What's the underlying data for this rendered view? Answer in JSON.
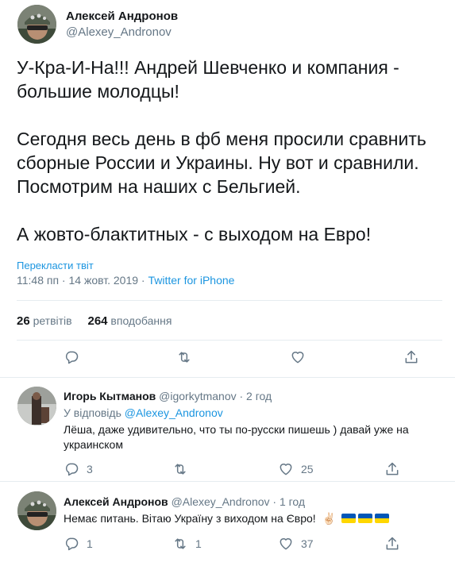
{
  "main_tweet": {
    "author_name": "Алексей Андронов",
    "author_handle": "@Alexey_Andronov",
    "text": "У-Кра-И-На!!! Андрей Шевченко и компания -\nбольшие молодцы!\n\nСегодня весь день в фб меня просили сравнить\nсборные России и Украины. Ну вот и сравнили.\nПосмотрим на наших с Бельгией.\n\nА жовто-блактитных - с выходом на Евро!",
    "translate_label": "Перекласти твіт",
    "time": "11:48 пп",
    "date": "14 жовт. 2019",
    "separator": " · ",
    "source": "Twitter for iPhone",
    "retweets_count": "26",
    "retweets_label": "ретвітів",
    "likes_count": "264",
    "likes_label": "вподобання"
  },
  "replies": [
    {
      "author_name": "Игорь Кытманов",
      "author_handle": "@igorkytmanov",
      "time": "· 2 год",
      "replying_to_prefix": "У відповідь",
      "replying_to_handle": "@Alexey_Andronov",
      "text": "Лёша, даже удивительно, что ты по-русски пишешь ) давай уже на украинском",
      "reply_count": "3",
      "retweet_count": "",
      "like_count": "25"
    },
    {
      "author_name": "Алексей Андронов",
      "author_handle": "@Alexey_Andronov",
      "time": "· 1 год",
      "text": "Немає питань. Вітаю Україну з виходом на Євро!",
      "emoji": "✌🏻",
      "reply_count": "1",
      "retweet_count": "1",
      "like_count": "37"
    }
  ],
  "icons": {
    "reply": "reply-icon",
    "retweet": "retweet-icon",
    "like": "heart-icon",
    "share": "share-icon"
  },
  "colors": {
    "link": "#1b95e0",
    "secondary_text": "#657786",
    "divider": "#e6ecf0",
    "flag_blue": "#0057b7",
    "flag_yellow": "#ffd700"
  }
}
